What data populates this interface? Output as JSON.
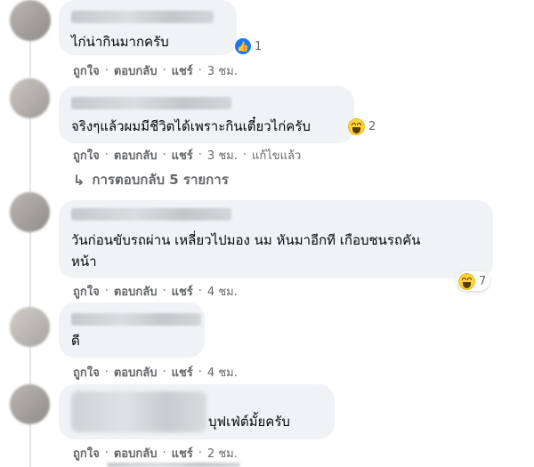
{
  "comments": [
    {
      "text": "ไก่น่ากินมากครับ",
      "reaction": "like",
      "reaction_count": "1",
      "actions": {
        "like": "ถูกใจ",
        "reply": "ตอบกลับ",
        "share": "แชร์",
        "time": "3 ชม."
      }
    },
    {
      "text": "จริงๆแล้วผมมีชีวิตได้เพราะกินเตี๋ยวไก่ครับ",
      "reaction": "haha",
      "reaction_count": "2",
      "actions": {
        "like": "ถูกใจ",
        "reply": "ตอบกลับ",
        "share": "แชร์",
        "time": "3 ชม.",
        "edited": "แก้ไขแล้ว"
      },
      "replies_label": "การตอบกลับ 5 รายการ"
    },
    {
      "text_line1": "วันก่อนขับรถผ่าน เหลี่ยวไปมอง นม หันมาอีกที เกือบชนรถคัน",
      "text_line2": "หน้า",
      "reaction": "haha",
      "reaction_count": "7",
      "actions": {
        "like": "ถูกใจ",
        "reply": "ตอบกลับ",
        "share": "แชร์",
        "time": "4 ชม."
      }
    },
    {
      "text": "ดี",
      "actions": {
        "like": "ถูกใจ",
        "reply": "ตอบกลับ",
        "share": "แชร์",
        "time": "4 ชม."
      }
    },
    {
      "text": "บุฟเฟ่ต์มั้ยครับ",
      "actions": {
        "like": "ถูกใจ",
        "reply": "ตอบกลับ",
        "share": "แชร์",
        "time": "2 ชม."
      }
    }
  ],
  "separator": "·",
  "icons": {
    "like": "thumbs-up-icon",
    "haha": "haha-emoji-icon",
    "replies": "reply-arrow-icon"
  },
  "colors": {
    "bubble": "#f0f2f5",
    "secondary_text": "#65676b",
    "like_blue": "#1877f2",
    "haha_yellow": "#fcd440"
  }
}
